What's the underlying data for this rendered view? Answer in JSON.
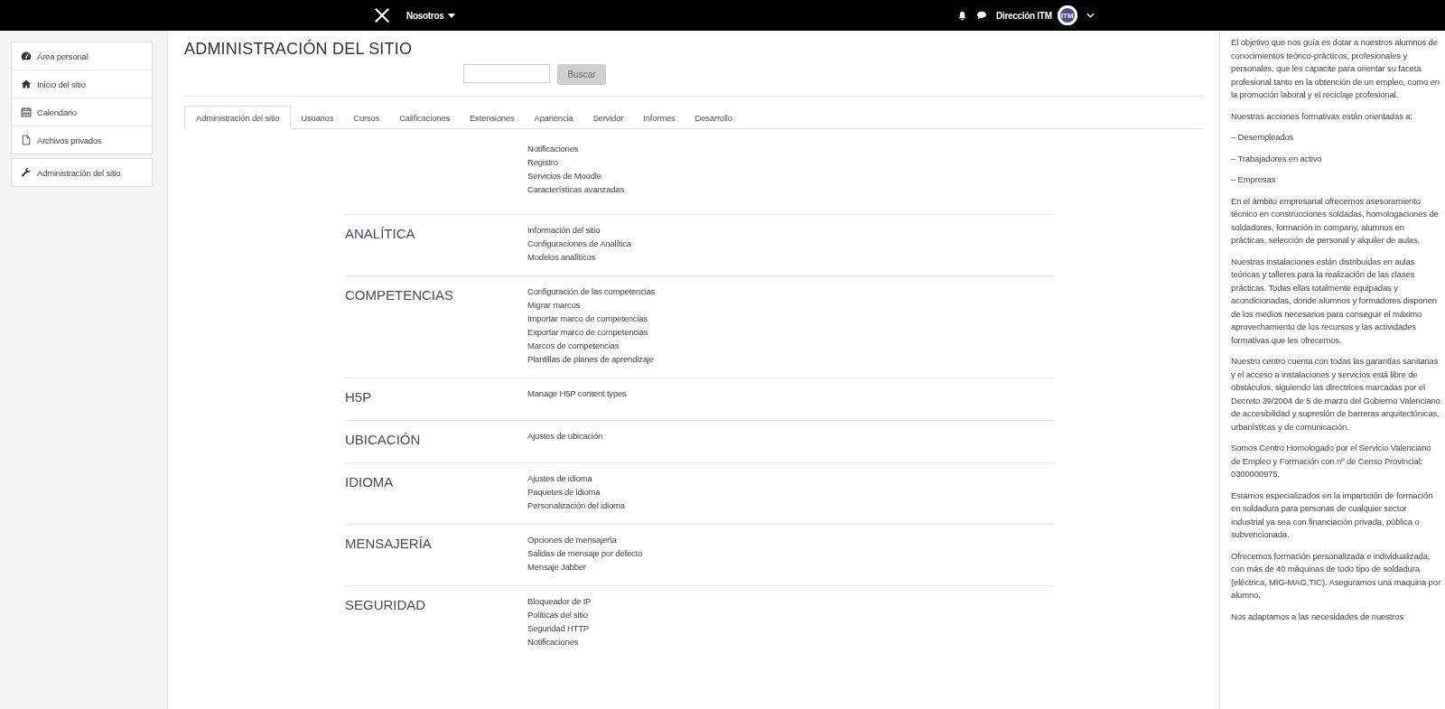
{
  "navbar": {
    "menu_label": "Nosotros",
    "user_name": "Dirección ITM",
    "avatar_text": "ITM"
  },
  "sidebar": {
    "items": [
      {
        "label": "Área personal"
      },
      {
        "label": "Inicio del sitio"
      },
      {
        "label": "Calendario"
      },
      {
        "label": "Archivos privados"
      }
    ],
    "admin_item": {
      "label": "Administración del sitio"
    }
  },
  "page": {
    "title": "ADMINISTRACIÓN DEL SITIO",
    "search_button": "Buscar"
  },
  "tabs": [
    {
      "label": "Administración del sitio",
      "selected": true
    },
    {
      "label": "Usuarios",
      "selected": false
    },
    {
      "label": "Cursos",
      "selected": false
    },
    {
      "label": "Calificaciones",
      "selected": false
    },
    {
      "label": "Extensiones",
      "selected": false
    },
    {
      "label": "Apariencia",
      "selected": false
    },
    {
      "label": "Servidor",
      "selected": false
    },
    {
      "label": "Informes",
      "selected": false
    },
    {
      "label": "Desarrollo",
      "selected": false
    }
  ],
  "sections": [
    {
      "links": [
        "Notificaciones",
        "Registro",
        "Servicios de Moodle",
        "Características avanzadas"
      ]
    },
    {
      "heading": "ANALÍTICA",
      "links": [
        "Información del sitio",
        "Configuraciones de Analítica",
        "Modelos analíticos"
      ]
    },
    {
      "heading": "COMPETENCIAS",
      "links": [
        "Configuración de las competencias",
        "Migrar marcos",
        "Importar marco de competencias",
        "Exportar marco de competencias",
        "Marcos de competencias",
        "Plantillas de planes de aprendizaje"
      ]
    },
    {
      "heading": "H5P",
      "links": [
        "Manage H5P content types"
      ]
    },
    {
      "heading": "UBICACIÓN",
      "links": [
        "Ajustes de ubicación"
      ]
    },
    {
      "heading": "IDIOMA",
      "links": [
        "Ajustes de idioma",
        "Paquetes de idioma",
        "Personalización del idioma"
      ]
    },
    {
      "heading": "MENSAJERÍA",
      "links": [
        "Opciones de mensajería",
        "Salidas de mensaje por defecto",
        "Mensaje Jabber"
      ]
    },
    {
      "heading": "SEGURIDAD",
      "links": [
        "Bloqueador de IP",
        "Políticas del sitio",
        "Seguridad HTTP",
        "Notificaciones"
      ]
    }
  ],
  "info_panel": {
    "paragraphs": [
      "El objetivo que nos guía es dotar a nuestros alumnos de conocimientos teórico-prácticos, profesionales y personales, que les capacite para orientar su faceta profesional tanto en la obtención de un empleo, como en la promoción laboral y el reciclaje profesional.",
      "Nuestras acciones formativas están orientadas a:",
      "– Desempleados",
      "– Trabajadores en activo",
      "– Empresas",
      "En el ámbito empresarial ofrecemos asesoramiento técnico en construcciones soldadas, homologaciones de soldadores, formación in company, alumnos en prácticas, selección de personal y alquiler de aulas.",
      "Nuestras instalaciones están distribuidas en aulas teóricas y talleres para la realización de las clases prácticas. Todas ellas totalmente equipadas y acondicionadas, donde alumnos y formadores disponen de los medios necesarios para conseguir el máximo aprovechamiento de los recursos y las actividades formativas que les ofrecemos.",
      "Nuestro centro cuenta con todas las garantías sanitarias y el acceso a instalaciones y servicios está libre de obstáculos, siguiendo las directrices marcadas por el Decreto 39/2004 de 5 de marzo del Gobierno Valenciano de accesibilidad y supresión de barreras arquitectónicas, urbanísticas y de comunicación.",
      "Somos Centro Homologado por el Servicio Valenciano de Empleo y Formación con nº de Censo Provincial: 0300000975.",
      "Estamos especializados en la impartición de formación en soldadura  para personas de cualquier sector industrial ya sea con financiación privada, pública o subvencionada.",
      "Ofrecemos formación personalizada e individualizada, con más de 40 máquinas de todo tipo de soldadura (eléctrica, MIG-MAG,TIC). Aseguramos una maquina por alumno.",
      "Nos adaptamos a las necesidades de nuestros"
    ]
  }
}
